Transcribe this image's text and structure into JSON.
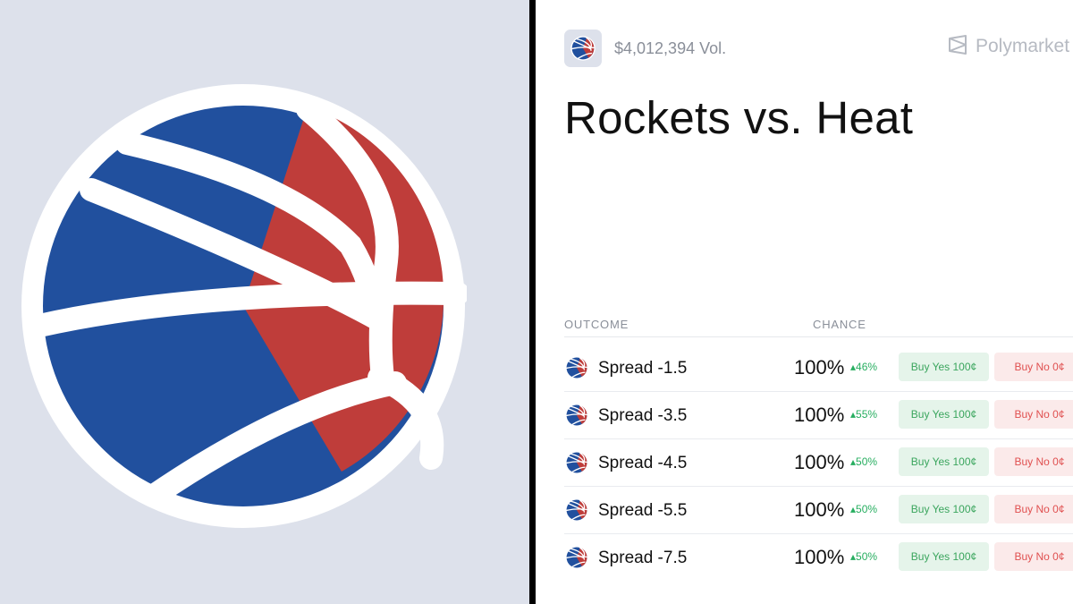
{
  "header": {
    "volume": "$4,012,394 Vol.",
    "brand": "Polymarket",
    "icon": "basketball-icon"
  },
  "event": {
    "title": "Rockets vs. Heat"
  },
  "table": {
    "columns": [
      "OUTCOME",
      "CHANCE"
    ],
    "rows": [
      {
        "label": "Spread -1.5",
        "chance": "100%",
        "delta": "▴46%",
        "yes": "Buy Yes 100¢",
        "no": "Buy No 0¢"
      },
      {
        "label": "Spread -3.5",
        "chance": "100%",
        "delta": "▴55%",
        "yes": "Buy Yes 100¢",
        "no": "Buy No 0¢"
      },
      {
        "label": "Spread -4.5",
        "chance": "100%",
        "delta": "▴50%",
        "yes": "Buy Yes 100¢",
        "no": "Buy No 0¢"
      },
      {
        "label": "Spread -5.5",
        "chance": "100%",
        "delta": "▴50%",
        "yes": "Buy Yes 100¢",
        "no": "Buy No 0¢"
      },
      {
        "label": "Spread -7.5",
        "chance": "100%",
        "delta": "▴50%",
        "yes": "Buy Yes 100¢",
        "no": "Buy No 0¢"
      }
    ]
  },
  "colors": {
    "blue": "#21509e",
    "red": "#bf3d3a",
    "panel_bg": "#dde1eb",
    "yes_bg": "#e5f4ea",
    "no_bg": "#fbeaea"
  }
}
